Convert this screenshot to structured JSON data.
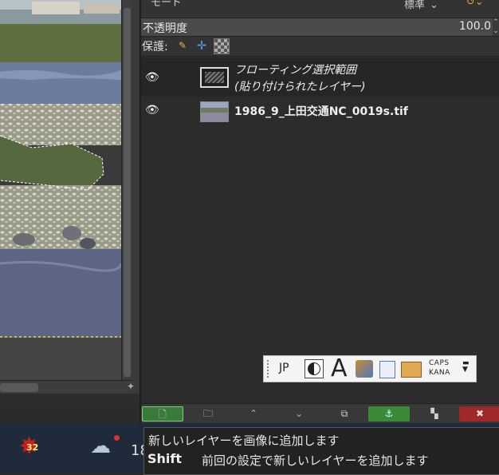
{
  "colors": {
    "panel_bg": "#333333",
    "accent_green": "#3a8a3a",
    "delete_red": "#a02828",
    "raise_lower_orange": "#e0a060"
  },
  "layers_panel": {
    "mode_label": "モード",
    "mode_value": "標準",
    "opacity_label": "不透明度",
    "opacity_value": "100.0",
    "protect_label": "保護:",
    "lock_icons": [
      "brush-icon",
      "move-icon",
      "checkerboard-icon"
    ],
    "layers": [
      {
        "name_line1": "フローティング選択範囲",
        "name_line2": "(貼り付けられたレイヤー)",
        "visible": true,
        "icon": "floating-selection-icon"
      },
      {
        "name": "1986_9_上田交通NC_0019s.tif",
        "visible": true
      }
    ]
  },
  "indicator": {
    "lang": "JP",
    "font_glyph": "A",
    "caps": "CAPS",
    "kana": "KANA",
    "icons": [
      "moon-icon",
      "font-icon",
      "tools-icon",
      "dictionary-icon",
      "box-icon",
      "menu-icon"
    ]
  },
  "toolbar": {
    "buttons": [
      "new-layer",
      "new-group",
      "raise",
      "lower",
      "duplicate",
      "anchor",
      "mask",
      "delete"
    ],
    "raise_glyph": "⌃",
    "lower_glyph": "⌄",
    "delete_glyph": "✖"
  },
  "tooltip": {
    "line1": "新しいレイヤーを画像に追加します",
    "shift_key": "Shift",
    "line2": "前回の設定で新しいレイヤーを追加します"
  },
  "taskbar": {
    "app_badge": "32",
    "temperature": "18"
  }
}
